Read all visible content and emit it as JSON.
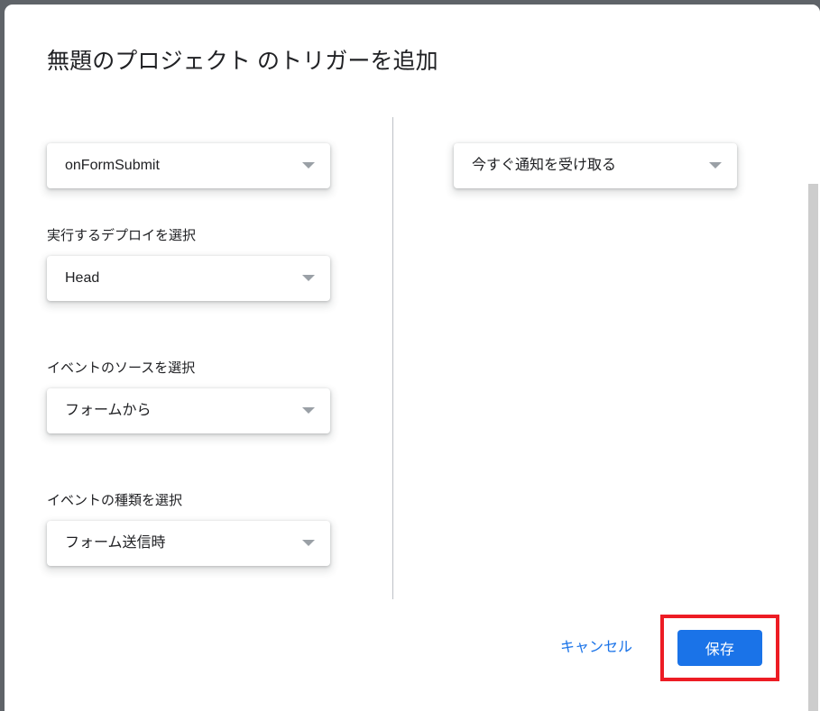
{
  "dialog": {
    "title": "無題のプロジェクト のトリガーを追加"
  },
  "left_column": {
    "fields": [
      {
        "name": "function",
        "label": "",
        "value": "onFormSubmit",
        "caret": "chevron-down-icon"
      },
      {
        "name": "deployment",
        "label": "実行するデプロイを選択",
        "value": "Head",
        "caret": "chevron-down-icon"
      },
      {
        "name": "event-source",
        "label": "イベントのソースを選択",
        "value": "フォームから",
        "caret": "chevron-down-icon"
      },
      {
        "name": "event-type",
        "label": "イベントの種類を選択",
        "value": "フォーム送信時",
        "caret": "chevron-down-icon"
      }
    ]
  },
  "right_column": {
    "fields": [
      {
        "name": "failure-notification",
        "label": "",
        "value": "今すぐ通知を受け取る",
        "caret": "chevron-down-icon"
      }
    ]
  },
  "footer": {
    "cancel_label": "キャンセル",
    "save_label": "保存"
  },
  "colors": {
    "accent_blue": "#1a73e8",
    "highlight_red": "#ed1c24",
    "backdrop": "#5f6368",
    "text_primary": "#202124",
    "divider": "#bdc1c6",
    "caret_gray": "#9aa0a6",
    "scrollbar_thumb": "#cdcdcd"
  }
}
